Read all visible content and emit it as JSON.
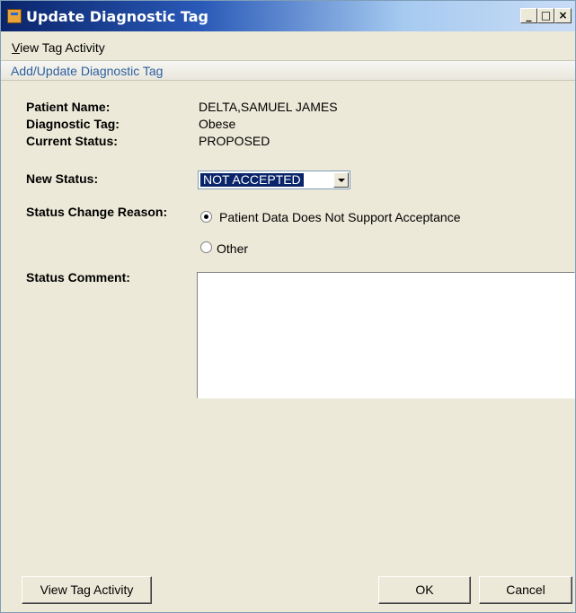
{
  "window": {
    "title": "Update Diagnostic Tag"
  },
  "window_controls": {
    "minimize": "_",
    "maximize": "□",
    "close": "×"
  },
  "menu": {
    "view_tag_activity_ul": "V",
    "view_tag_activity_rest": "iew Tag Activity"
  },
  "section": {
    "title": "Add/Update Diagnostic Tag"
  },
  "fields": {
    "patient_name_label": "Patient Name:",
    "patient_name_value": "DELTA,SAMUEL JAMES",
    "diagnostic_tag_label": "Diagnostic Tag:",
    "diagnostic_tag_value": "Obese",
    "current_status_label": "Current Status:",
    "current_status_value": "PROPOSED",
    "new_status_label": "New Status:",
    "new_status_value": "NOT ACCEPTED",
    "status_change_reason_label": "Status Change Reason:",
    "status_comment_label": "Status Comment:",
    "status_comment_value": ""
  },
  "reasons": [
    {
      "label": "Patient Data Does Not Support Acceptance",
      "checked": true
    },
    {
      "label": "Other",
      "checked": false
    }
  ],
  "buttons": {
    "view_tag_activity": "View Tag Activity",
    "ok": "OK",
    "cancel": "Cancel"
  }
}
